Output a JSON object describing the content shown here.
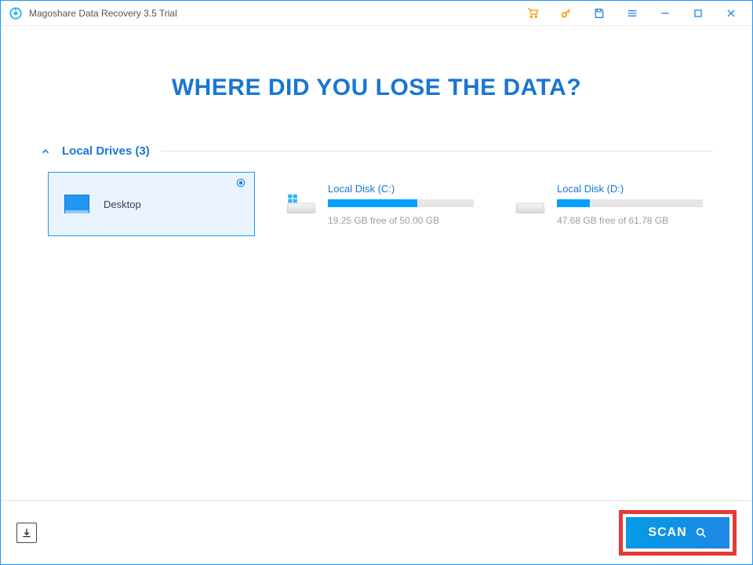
{
  "app": {
    "title": "Magoshare Data Recovery 3.5 Trial"
  },
  "titlebar": {
    "icons": {
      "cart": "cart-icon",
      "key": "key-icon",
      "save": "save-icon",
      "menu": "menu-icon",
      "minimize": "minimize-icon",
      "maximize": "maximize-icon",
      "close": "close-icon"
    }
  },
  "headline": "WHERE DID YOU LOSE THE DATA?",
  "section": {
    "title": "Local Drives (3)",
    "expanded": true
  },
  "drives": [
    {
      "id": "desktop",
      "type": "desktop",
      "label": "Desktop",
      "selected": true
    },
    {
      "id": "c",
      "type": "disk",
      "os_icon": "windows",
      "label": "Local Disk (C:)",
      "free_gb": 19.25,
      "total_gb": 50.0,
      "used_percent": 61.5,
      "free_text": "19.25 GB free of 50.00 GB"
    },
    {
      "id": "d",
      "type": "disk",
      "os_icon": null,
      "label": "Local Disk (D:)",
      "free_gb": 47.68,
      "total_gb": 61.78,
      "used_percent": 22.8,
      "free_text": "47.68 GB free of 61.78 GB"
    }
  ],
  "footer": {
    "scan_label": "SCAN",
    "scan_highlighted": true
  }
}
